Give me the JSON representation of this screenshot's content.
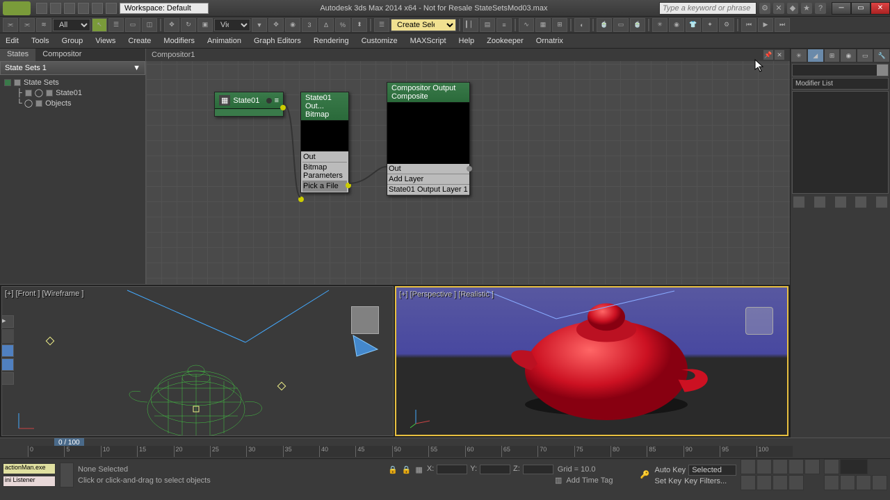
{
  "titlebar": {
    "workspace_label": "Workspace: Default",
    "title": "Autodesk 3ds Max  2014 x64  - Not for Resale     StateSetsMod03.max",
    "search_placeholder": "Type a keyword or phrase"
  },
  "toolbar": {
    "sel_filter": "All",
    "ref_sys": "View",
    "named_sel": "Create Selection Se"
  },
  "menu": [
    "Edit",
    "Tools",
    "Group",
    "Views",
    "Create",
    "Modifiers",
    "Animation",
    "Graph Editors",
    "Rendering",
    "Customize",
    "MAXScript",
    "Help",
    "Zookeeper",
    "Ornatrix"
  ],
  "state_panel": {
    "tab_states": "States",
    "tab_compositor": "Compositor",
    "header": "State Sets 1",
    "root": "State Sets",
    "item1": "State01",
    "item2": "Objects"
  },
  "compositor": {
    "title": "Compositor1",
    "node_state": "State01",
    "node_bitmap_t1": "State01 Out...",
    "node_bitmap_t2": "Bitmap",
    "node_bitmap_out": "Out",
    "node_bitmap_params": "Bitmap Parameters",
    "node_bitmap_pick": "Pick a File",
    "node_output_t1": "Compositor Output",
    "node_output_t2": "Composite",
    "node_output_out": "Out",
    "node_output_add": "Add Layer",
    "node_output_s1": "State01 Output Layer 1"
  },
  "viewports": {
    "front": "[+] [Front ] [Wireframe ]",
    "persp": "[+] [Perspective ] [Realistic ]"
  },
  "right_panel": {
    "modifier_list": "Modifier List"
  },
  "timeline": {
    "frame": "0 / 100",
    "ticks": [
      "0",
      "5",
      "10",
      "15",
      "20",
      "25",
      "30",
      "35",
      "40",
      "45",
      "50",
      "55",
      "60",
      "65",
      "70",
      "75",
      "80",
      "85",
      "90",
      "95",
      "100"
    ]
  },
  "bottom": {
    "script1": "actionMan.exe",
    "script2": "ini Listener",
    "none_selected": "None Selected",
    "hint": "Click or click-and-drag to select objects",
    "x": "X:",
    "y": "Y:",
    "z": "Z:",
    "grid": "Grid = 10.0",
    "add_time_tag": "Add Time Tag",
    "auto_key": "Auto Key",
    "set_key": "Set Key",
    "selected": "Selected",
    "key_filters": "Key Filters..."
  },
  "win_btns": {
    "min": "─",
    "max": "▭",
    "close": "✕"
  }
}
